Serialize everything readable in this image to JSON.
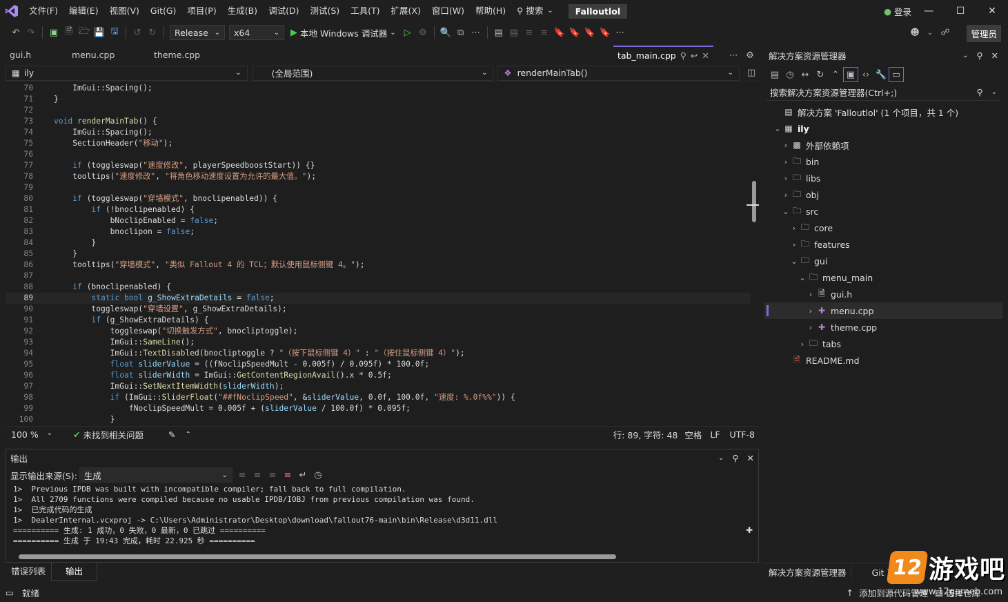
{
  "titlebar": {
    "menu": [
      "文件(F)",
      "编辑(E)",
      "视图(V)",
      "Git(G)",
      "项目(P)",
      "生成(B)",
      "调试(D)",
      "测试(S)",
      "工具(T)",
      "扩展(X)",
      "窗口(W)",
      "帮助(H)"
    ],
    "search_label": "搜索",
    "solution_name": "Falloutlol",
    "login_label": "登录"
  },
  "toolbar": {
    "config": "Release",
    "platform": "x64",
    "debug_target": "本地 Windows 调试器",
    "admin_label": "管理员"
  },
  "editor": {
    "tabs": [
      "gui.h",
      "menu.cpp",
      "theme.cpp"
    ],
    "active_tab": "tab_main.cpp",
    "nav_project": "ily",
    "nav_scope": "(全局范围)",
    "nav_member": "renderMainTab()",
    "current_line": 89,
    "lines": [
      {
        "n": 70,
        "indent": 4,
        "html": "ImGui::Spacing();"
      },
      {
        "n": 71,
        "indent": 0,
        "html": "}"
      },
      {
        "n": 72,
        "indent": 0,
        "html": ""
      },
      {
        "n": 73,
        "indent": 0,
        "html": "<span class='kw'>void</span> <span class='fn'>renderMainTab</span>() {"
      },
      {
        "n": 74,
        "indent": 4,
        "html": "ImGui::Spacing();"
      },
      {
        "n": 75,
        "indent": 4,
        "html": "SectionHeader(<span class='str'>\"移动\"</span>);"
      },
      {
        "n": 76,
        "indent": 0,
        "html": ""
      },
      {
        "n": 77,
        "indent": 4,
        "html": "<span class='kw'>if</span> (toggleswap(<span class='str'>\"速度修改\"</span>, playerSpeedboostStart)) {}"
      },
      {
        "n": 78,
        "indent": 4,
        "html": "tooltips(<span class='str'>\"速度修改\"</span>, <span class='str'>\"将角色移动速度设置为允许的最大值。\"</span>);"
      },
      {
        "n": 79,
        "indent": 0,
        "html": ""
      },
      {
        "n": 80,
        "indent": 4,
        "html": "<span class='kw'>if</span> (toggleswap(<span class='str'>\"穿墙模式\"</span>, bnoclipenabled)) {"
      },
      {
        "n": 81,
        "indent": 8,
        "html": "<span class='kw'>if</span> (!bnoclipenabled) {"
      },
      {
        "n": 82,
        "indent": 12,
        "html": "bNoclipEnabled = <span class='kw'>false</span>;"
      },
      {
        "n": 83,
        "indent": 12,
        "html": "bnoclipon = <span class='kw'>false</span>;"
      },
      {
        "n": 84,
        "indent": 8,
        "html": "}"
      },
      {
        "n": 85,
        "indent": 4,
        "html": "}"
      },
      {
        "n": 86,
        "indent": 4,
        "html": "tooltips(<span class='str'>\"穿墙模式\"</span>, <span class='str'>\"类似 Fallout 4 的 TCL；默认使用鼠标侧键 4。\"</span>);"
      },
      {
        "n": 87,
        "indent": 0,
        "html": ""
      },
      {
        "n": 88,
        "indent": 4,
        "html": "<span class='kw'>if</span> (bnoclipenabled) {"
      },
      {
        "n": 89,
        "indent": 8,
        "html": "<span class='kw'>static bool</span> <span class='var'>g_ShowExtraDetails</span> = <span class='kw'>false</span>;"
      },
      {
        "n": 90,
        "indent": 8,
        "html": "toggleswap(<span class='str'>\"穿墙设置\"</span>, g_ShowExtraDetails);"
      },
      {
        "n": 91,
        "indent": 8,
        "html": "<span class='kw'>if</span> (g_ShowExtraDetails) {"
      },
      {
        "n": 92,
        "indent": 12,
        "html": "toggleswap(<span class='str'>\"切换触发方式\"</span>, bnocliptoggle);"
      },
      {
        "n": 93,
        "indent": 12,
        "html": "ImGui::<span class='fn'>SameLine</span>();"
      },
      {
        "n": 94,
        "indent": 12,
        "html": "ImGui::<span class='fn'>TextDisabled</span>(bnocliptoggle ? <span class='str'>\"（按下鼠标侧键 4）\"</span> : <span class='str'>\"（按住鼠标侧键 4）\"</span>);"
      },
      {
        "n": 95,
        "indent": 12,
        "html": "<span class='kw'>float</span> <span class='var'>sliderValue</span> = ((fNoclipSpeedMult - 0.005f) / 0.095f) * 100.0f;"
      },
      {
        "n": 96,
        "indent": 12,
        "html": "<span class='kw'>float</span> <span class='var'>sliderWidth</span> = ImGui::<span class='fn'>GetContentRegionAvail</span>().x * 0.5f;"
      },
      {
        "n": 97,
        "indent": 12,
        "html": "ImGui::<span class='fn'>SetNextItemWidth</span>(<span class='var'>sliderWidth</span>);"
      },
      {
        "n": 98,
        "indent": 12,
        "html": "<span class='kw'>if</span> (ImGui::<span class='fn'>SliderFloat</span>(<span class='str'>\"##fNoclipSpeed\"</span>, &amp;<span class='var'>sliderValue</span>, 0.0f, 100.0f, <span class='str'>\"速度: %.0f%%\"</span>)) {"
      },
      {
        "n": 99,
        "indent": 16,
        "html": "fNoclipSpeedMult = 0.005f + (<span class='var'>sliderValue</span> / 100.0f) * 0.095f;"
      },
      {
        "n": 100,
        "indent": 12,
        "html": "}"
      }
    ]
  },
  "editor_status": {
    "zoom": "100 %",
    "issues": "未找到相关问题",
    "position": "行: 89, 字符: 48",
    "whitespace": "空格",
    "line_ending": "LF",
    "encoding": "UTF-8"
  },
  "output": {
    "title": "输出",
    "source_label": "显示输出来源(S):",
    "source_value": "生成",
    "lines": [
      "1>  Previous IPDB was built with incompatible compiler; fall back to full compilation.",
      "1>  All 2709 functions were compiled because no usable IPDB/IOBJ from previous compilation was found.",
      "1>  已完成代码的生成",
      "1>  DealerInternal.vcxproj -> C:\\Users\\Administrator\\Desktop\\download\\fallout76-main\\bin\\Release\\d3d11.dll",
      "========== 生成: 1 成功，0 失败，0 最新，0 已跳过 ==========",
      "========== 生成 于 19:43 完成，耗时 22.925 秒 =========="
    ]
  },
  "bottom_tabs": [
    "错误列表",
    "输出"
  ],
  "solution_explorer": {
    "title": "解决方案资源管理器",
    "search_placeholder": "搜索解决方案资源管理器(Ctrl+;)",
    "items": [
      {
        "label": "解决方案 'Falloutlol' (1 个项目，共 1 个)",
        "depth": 0,
        "chev": "",
        "icon": "sln"
      },
      {
        "label": "ily",
        "depth": 0,
        "chev": "open",
        "icon": "proj",
        "bold": true
      },
      {
        "label": "外部依赖项",
        "depth": 1,
        "chev": "closed",
        "icon": "deps"
      },
      {
        "label": "bin",
        "depth": 1,
        "chev": "closed",
        "icon": "folder"
      },
      {
        "label": "libs",
        "depth": 1,
        "chev": "closed",
        "icon": "folder"
      },
      {
        "label": "obj",
        "depth": 1,
        "chev": "closed",
        "icon": "folder"
      },
      {
        "label": "src",
        "depth": 1,
        "chev": "open",
        "icon": "folder"
      },
      {
        "label": "core",
        "depth": 2,
        "chev": "closed",
        "icon": "folder"
      },
      {
        "label": "features",
        "depth": 2,
        "chev": "closed",
        "icon": "folder"
      },
      {
        "label": "gui",
        "depth": 2,
        "chev": "open",
        "icon": "folder"
      },
      {
        "label": "menu_main",
        "depth": 3,
        "chev": "open",
        "icon": "folder"
      },
      {
        "label": "gui.h",
        "depth": 4,
        "chev": "closed",
        "icon": "h"
      },
      {
        "label": "menu.cpp",
        "depth": 4,
        "chev": "closed",
        "icon": "cpp",
        "selected": true
      },
      {
        "label": "theme.cpp",
        "depth": 4,
        "chev": "closed",
        "icon": "cpp"
      },
      {
        "label": "tabs",
        "depth": 3,
        "chev": "closed",
        "icon": "folder"
      },
      {
        "label": "README.md",
        "depth": 1,
        "chev": "",
        "icon": "md"
      }
    ],
    "bottom_tabs": [
      "解决方案资源管理器",
      "Git 更改"
    ]
  },
  "statusbar": {
    "ready": "就绪",
    "add_source": "添加到源代码管理",
    "repo": "选择仓库"
  },
  "watermark": {
    "logo_text": "12",
    "text": "游戏吧",
    "url": "www.12gameb.com"
  },
  "colors": {
    "accent": "#7b6ad8",
    "background": "#1f1f1f",
    "editor_bg": "#1e1e1e"
  }
}
